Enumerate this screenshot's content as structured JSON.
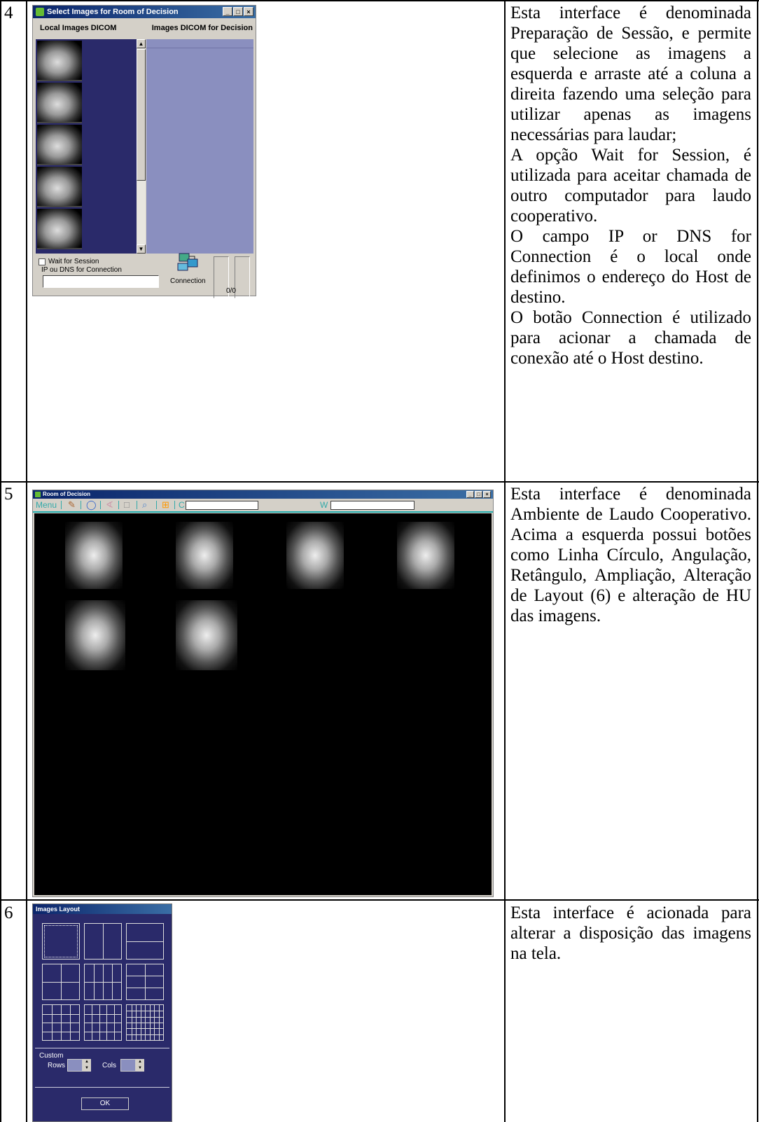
{
  "rows": [
    {
      "number": "4",
      "description": [
        "Esta interface é denominada Preparação de Sessão, e permite que selecione as imagens a esquerda e arraste até a coluna a direita fazendo uma seleção para utilizar apenas as imagens necessárias para laudar;",
        "A opção Wait for Session, é utilizada para aceitar chamada de outro computador para laudo cooperativo.",
        "O campo IP or DNS for Connection é o local onde definimos o endereço do Host de destino.",
        "O botão Connection é utilizado para acionar a chamada de conexão até o Host destino."
      ]
    },
    {
      "number": "5",
      "description": [
        "Esta interface é denominada Ambiente de Laudo Cooperativo. Acima a esquerda possui botões como Linha Círculo, Angulação, Retângulo, Ampliação, Alteração de Layout (6) e alteração de HU das imagens."
      ]
    },
    {
      "number": "6",
      "description": [
        "Esta interface é acionada para alterar a disposição das imagens na tela."
      ]
    }
  ],
  "select_window": {
    "title": "Select Images for Room of Decision",
    "left_header": "Local Images DICOM",
    "right_header": "Images DICOM for Decision",
    "wait_label": "Wait for Session",
    "ip_label": "IP ou DNS for Connection",
    "ip_value": "",
    "connection_label": "Connection",
    "counter": "0/0",
    "thumbnail_count": 5
  },
  "room_window": {
    "title": "Room of Decision",
    "menu_label": "Menu",
    "c_label": "C",
    "w_label": "W",
    "c_value": "",
    "w_value": "",
    "tools": [
      "pencil-icon",
      "circle-icon",
      "angle-icon",
      "rectangle-icon",
      "zoom-icon",
      "layout-icon"
    ],
    "image_count": 6
  },
  "layout_window": {
    "title": "Images Layout",
    "custom_label": "Custom",
    "rows_label": "Rows",
    "cols_label": "Cols",
    "ok_label": "OK",
    "layouts": [
      "1x1",
      "1x2",
      "2x1",
      "2x2",
      "2x4",
      "3x2",
      "4x4",
      "4x5",
      "6x8"
    ]
  }
}
